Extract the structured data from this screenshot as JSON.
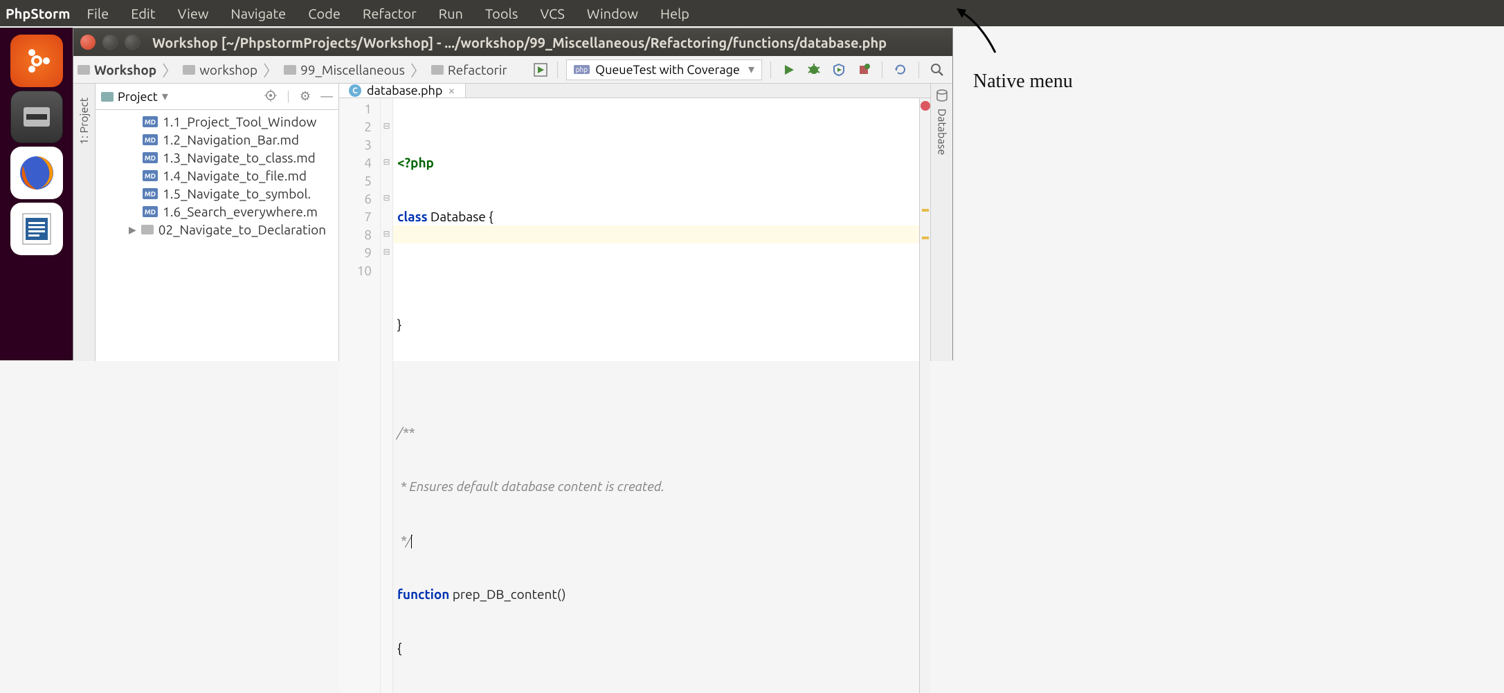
{
  "menubar": {
    "app": "PhpStorm",
    "items": [
      "File",
      "Edit",
      "View",
      "Navigate",
      "Code",
      "Refactor",
      "Run",
      "Tools",
      "VCS",
      "Window",
      "Help"
    ]
  },
  "window": {
    "title": "Workshop [~/PhpstormProjects/Workshop] - .../workshop/99_Miscellaneous/Refactoring/functions/database.php"
  },
  "breadcrumbs": [
    "Workshop",
    "workshop",
    "99_Miscellaneous",
    "Refactorir"
  ],
  "run_config": {
    "label": "QueueTest with Coverage"
  },
  "project_panel": {
    "title": "Project",
    "vert_label": "1: Project",
    "items": [
      {
        "name": "1.1_Project_Tool_Window",
        "icon": "MD"
      },
      {
        "name": "1.2_Navigation_Bar.md",
        "icon": "MD"
      },
      {
        "name": "1.3_Navigate_to_class.md",
        "icon": "MD"
      },
      {
        "name": "1.4_Navigate_to_file.md",
        "icon": "MD"
      },
      {
        "name": "1.5_Navigate_to_symbol.",
        "icon": "MD"
      },
      {
        "name": "1.6_Search_everywhere.m",
        "icon": "MD"
      },
      {
        "name": "02_Navigate_to_Declaration",
        "icon": "folder",
        "expandable": true
      }
    ]
  },
  "tabs": [
    {
      "label": "database.php",
      "icon": "C"
    }
  ],
  "database_panel": "Database",
  "editor": {
    "lines": [
      1,
      2,
      3,
      4,
      5,
      6,
      7,
      8,
      9,
      10
    ],
    "cursor_line": 8,
    "code": {
      "l1_php": "<?php",
      "l2_kw": "class",
      "l2_rest": " Database {",
      "l4": "}",
      "l6": "/**",
      "l7": " * Ensures default database content is created.",
      "l8": " */",
      "l9_kw": "function",
      "l9_rest": " prep_DB_content()",
      "l10": "{"
    }
  },
  "annotation": "Native menu"
}
